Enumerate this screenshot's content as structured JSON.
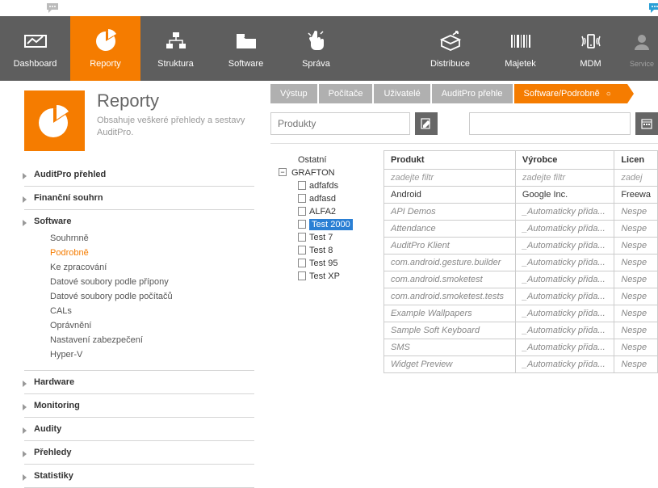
{
  "chat_icons": {
    "left": "chat",
    "right": "chat"
  },
  "nav": [
    {
      "id": "dashboard",
      "label": "Dashboard"
    },
    {
      "id": "reporty",
      "label": "Reporty",
      "active": true
    },
    {
      "id": "struktura",
      "label": "Struktura"
    },
    {
      "id": "software",
      "label": "Software"
    },
    {
      "id": "sprava",
      "label": "Správa"
    },
    {
      "id": "distribuce",
      "label": "Distribuce"
    },
    {
      "id": "majetek",
      "label": "Majetek"
    },
    {
      "id": "mdm",
      "label": "MDM"
    },
    {
      "id": "service",
      "label": "Service",
      "faded": true
    }
  ],
  "page": {
    "title": "Reporty",
    "desc": "Obsahuje veškeré přehledy a sestavy AuditPro."
  },
  "side_menu": [
    {
      "label": "AuditPro přehled"
    },
    {
      "label": "Finanční souhrn"
    },
    {
      "label": "Software",
      "expanded": true,
      "items": [
        {
          "label": "Souhrnně"
        },
        {
          "label": "Podrobně",
          "active": true
        },
        {
          "label": "Ke zpracování"
        },
        {
          "label": "Datové soubory podle přípony"
        },
        {
          "label": "Datové soubory podle počítačů"
        },
        {
          "label": "CALs"
        },
        {
          "label": "Oprávnění"
        },
        {
          "label": "Nastavení zabezpečení"
        },
        {
          "label": "Hyper-V"
        }
      ]
    },
    {
      "label": "Hardware"
    },
    {
      "label": "Monitoring"
    },
    {
      "label": "Audity"
    },
    {
      "label": "Přehledy"
    },
    {
      "label": "Statistiky"
    }
  ],
  "tabs": [
    {
      "label": "Výstup"
    },
    {
      "label": "Počítače"
    },
    {
      "label": "Uživatelé"
    },
    {
      "label": "AuditPro přehle"
    },
    {
      "label": "Software/Podrobně",
      "active": true
    }
  ],
  "filter": {
    "placeholder": "Produkty"
  },
  "tree": {
    "root": "Ostatní",
    "parent": "GRAFTON",
    "leaves": [
      {
        "label": "adfafds"
      },
      {
        "label": "adfasd"
      },
      {
        "label": "ALFA2"
      },
      {
        "label": "Test 2000",
        "selected": true
      },
      {
        "label": "Test 7"
      },
      {
        "label": "Test 8"
      },
      {
        "label": "Test 95"
      },
      {
        "label": "Test XP"
      }
    ]
  },
  "grid": {
    "columns": [
      "Produkt",
      "Výrobce",
      "Licen"
    ],
    "filter_row": [
      "zadejte filtr",
      "zadejte filtr",
      "zadej"
    ],
    "rows": [
      {
        "cells": [
          "Android",
          "Google Inc.",
          "Freewa"
        ],
        "muted": false
      },
      {
        "cells": [
          "API Demos",
          "_Automaticky přida...",
          "Nespe"
        ],
        "muted": true
      },
      {
        "cells": [
          "Attendance",
          "_Automaticky přida...",
          "Nespe"
        ],
        "muted": true
      },
      {
        "cells": [
          "AuditPro Klient",
          "_Automaticky přida...",
          "Nespe"
        ],
        "muted": true
      },
      {
        "cells": [
          "com.android.gesture.builder",
          "_Automaticky přida...",
          "Nespe"
        ],
        "muted": true
      },
      {
        "cells": [
          "com.android.smoketest",
          "_Automaticky přida...",
          "Nespe"
        ],
        "muted": true
      },
      {
        "cells": [
          "com.android.smoketest.tests",
          "_Automaticky přida...",
          "Nespe"
        ],
        "muted": true
      },
      {
        "cells": [
          "Example Wallpapers",
          "_Automaticky přida...",
          "Nespe"
        ],
        "muted": true
      },
      {
        "cells": [
          "Sample Soft Keyboard",
          "_Automaticky přida...",
          "Nespe"
        ],
        "muted": true
      },
      {
        "cells": [
          "SMS",
          "_Automaticky přida...",
          "Nespe"
        ],
        "muted": true
      },
      {
        "cells": [
          "Widget Preview",
          "_Automaticky přida...",
          "Nespe"
        ],
        "muted": true
      }
    ]
  }
}
